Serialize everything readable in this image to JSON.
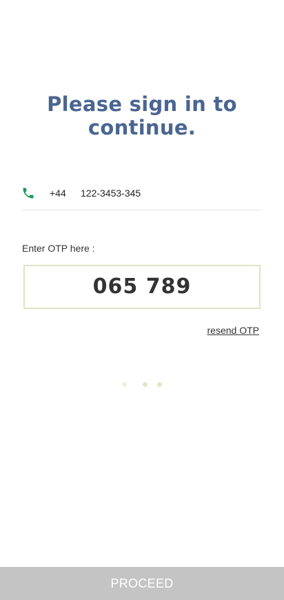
{
  "header": {
    "title": "Please sign in to continue."
  },
  "phone": {
    "icon": "phone-icon",
    "icon_color": "#1a9a5a",
    "country_code": "+44",
    "number": "122-3453-345"
  },
  "otp": {
    "label": "Enter OTP here :",
    "value": "065 789",
    "resend_label": "resend OTP",
    "border_color": "#dfe3c3"
  },
  "progress": {
    "total_steps": 3,
    "dot_colors": [
      "#eef0e0",
      "#dfe6c4",
      "#dfe6c4"
    ]
  },
  "footer": {
    "proceed_label": "PROCEED",
    "button_color": "#c4c4c4"
  },
  "colors": {
    "title": "#4a6591",
    "background": "#ffffff"
  }
}
